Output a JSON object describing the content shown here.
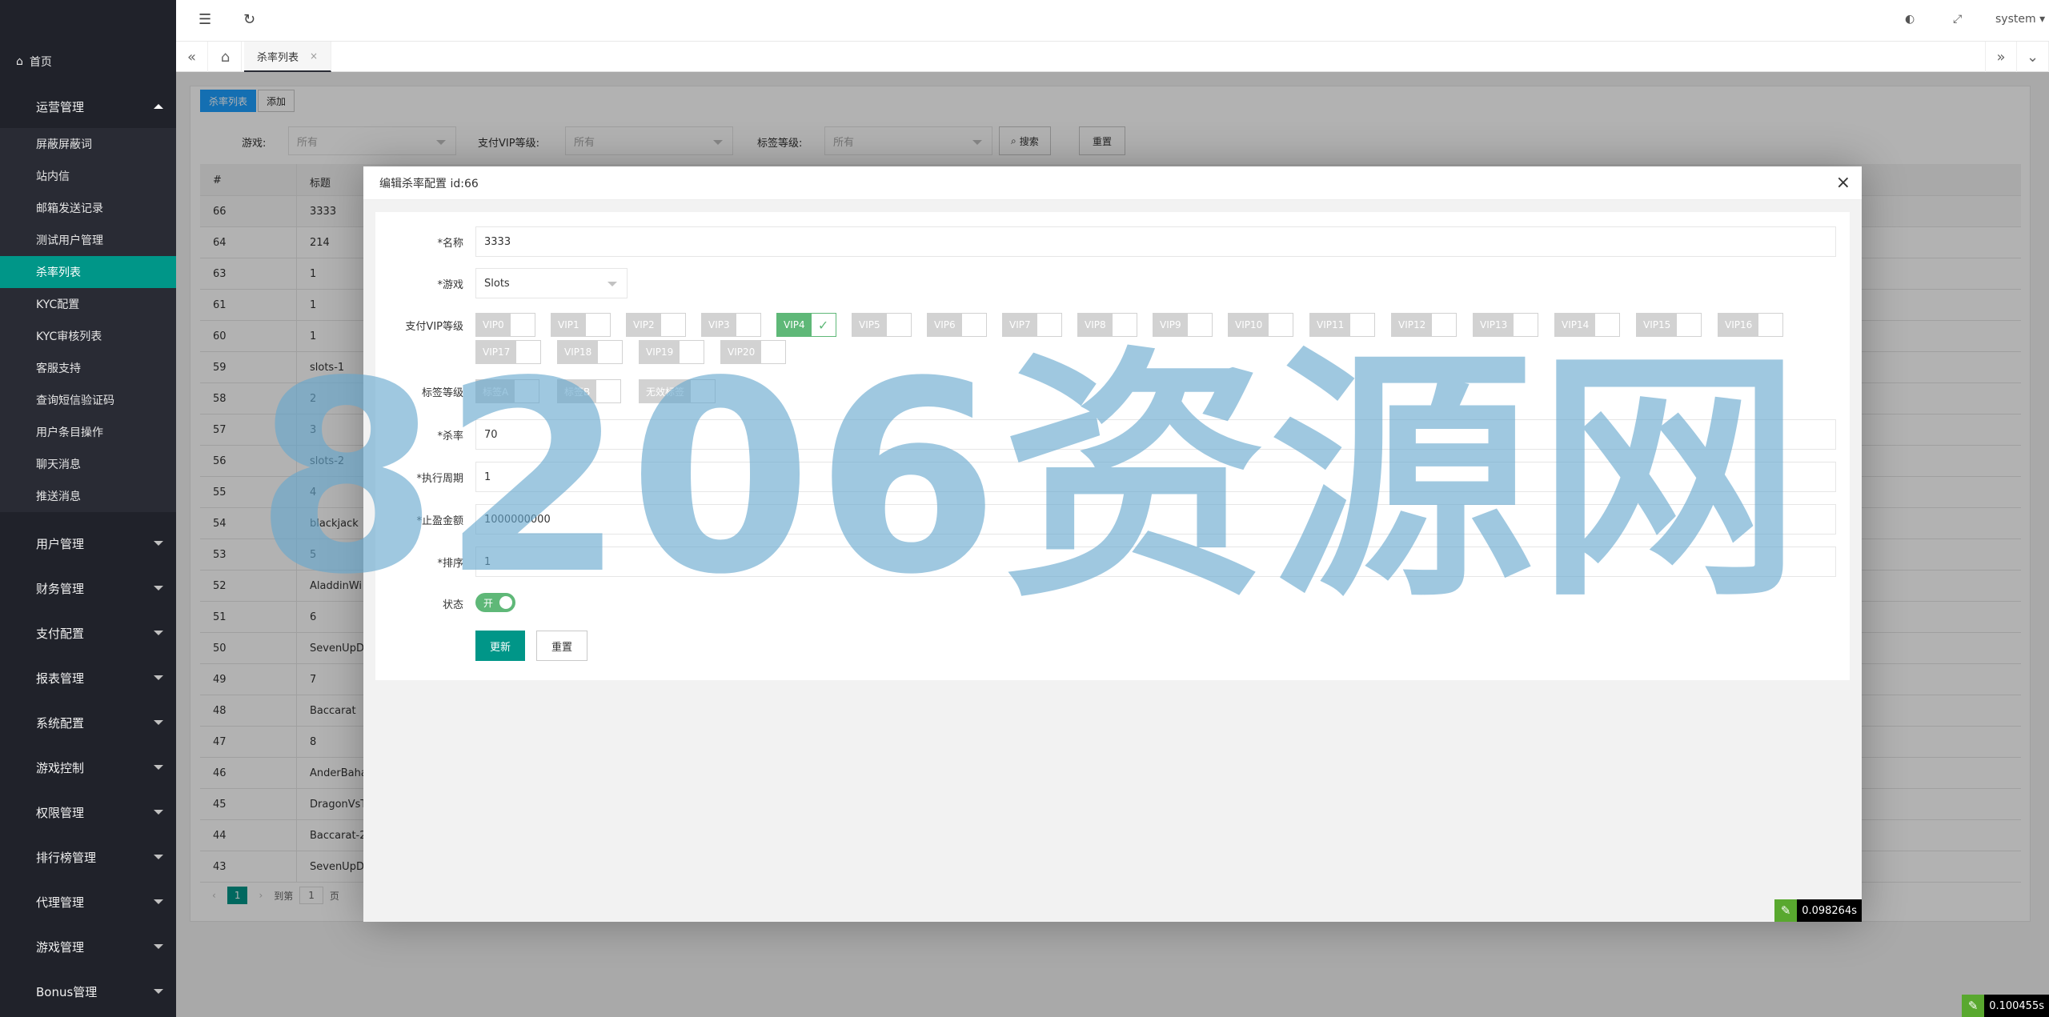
{
  "sidebar": {
    "home_label": "首页",
    "groups": [
      {
        "label": "运营管理",
        "expanded": true
      },
      {
        "label": "用户管理"
      },
      {
        "label": "财务管理"
      },
      {
        "label": "支付配置"
      },
      {
        "label": "报表管理"
      },
      {
        "label": "系统配置"
      },
      {
        "label": "游戏控制"
      },
      {
        "label": "权限管理"
      },
      {
        "label": "排行榜管理"
      },
      {
        "label": "代理管理"
      },
      {
        "label": "游戏管理"
      },
      {
        "label": "Bonus管理"
      }
    ],
    "sub_items": [
      {
        "label": "屏蔽屏蔽词"
      },
      {
        "label": "站内信"
      },
      {
        "label": "邮箱发送记录"
      },
      {
        "label": "测试用户管理"
      },
      {
        "label": "杀率列表",
        "active": true
      },
      {
        "label": "KYC配置"
      },
      {
        "label": "KYC审核列表"
      },
      {
        "label": "客服支持"
      },
      {
        "label": "查询短信验证码"
      },
      {
        "label": "用户条目操作"
      },
      {
        "label": "聊天消息"
      },
      {
        "label": "推送消息"
      }
    ]
  },
  "header": {
    "user": "system",
    "menu_icon": "menu-fold-icon",
    "refresh_icon": "refresh-icon"
  },
  "tabs": {
    "current": "杀率列表",
    "close": "×"
  },
  "content": {
    "btn_list": "杀率列表",
    "btn_add": "添加",
    "filters": {
      "game_label": "游戏:",
      "game_value": "所有",
      "vip_label": "支付VIP等级:",
      "vip_value": "所有",
      "tag_label": "标签等级:",
      "tag_value": "所有",
      "search": "搜索",
      "reset": "重置"
    },
    "table": {
      "headers": [
        "#",
        "标题"
      ],
      "rows": [
        [
          "66",
          "3333"
        ],
        [
          "64",
          "214"
        ],
        [
          "63",
          "1"
        ],
        [
          "61",
          "1"
        ],
        [
          "60",
          "1"
        ],
        [
          "59",
          "slots-1"
        ],
        [
          "58",
          "2"
        ],
        [
          "57",
          "3"
        ],
        [
          "56",
          "slots-2"
        ],
        [
          "55",
          "4"
        ],
        [
          "54",
          "blackjack"
        ],
        [
          "53",
          "5"
        ],
        [
          "52",
          "AladdinWi"
        ],
        [
          "51",
          "6"
        ],
        [
          "50",
          "SevenUpD"
        ],
        [
          "49",
          "7"
        ],
        [
          "48",
          "Baccarat"
        ],
        [
          "47",
          "8"
        ],
        [
          "46",
          "AnderBaha"
        ],
        [
          "45",
          "DragonVsT"
        ],
        [
          "44",
          "Baccarat-2"
        ],
        [
          "43",
          "SevenUpD"
        ]
      ]
    },
    "pager": {
      "current": "1",
      "goto": "到第",
      "input": "1",
      "page": "页"
    }
  },
  "modal": {
    "title": "编辑杀率配置 id:66",
    "fields": {
      "name_label": "*名称",
      "name_value": "3333",
      "game_label": "*游戏",
      "game_value": "Slots",
      "vip_label": "支付VIP等级",
      "vip_options": [
        "VIP0",
        "VIP1",
        "VIP2",
        "VIP3",
        "VIP4",
        "VIP5",
        "VIP6",
        "VIP7",
        "VIP8",
        "VIP9",
        "VIP10",
        "VIP11",
        "VIP12",
        "VIP13",
        "VIP14",
        "VIP15",
        "VIP16",
        "VIP17",
        "VIP18",
        "VIP19",
        "VIP20"
      ],
      "vip_checked": "VIP4",
      "tag_label": "标签等级",
      "tag_options": [
        "标签A",
        "标签B",
        "无效标签"
      ],
      "rate_label": "*杀率",
      "rate_value": "70",
      "period_label": "*执行周期",
      "period_value": "1",
      "stop_label": "*止盈金额",
      "stop_value": "1000000000",
      "sort_label": "*排序",
      "sort_value": "1",
      "status_label": "状态",
      "status_value": "开"
    },
    "update_btn": "更新",
    "reset_btn": "重置"
  },
  "timers": {
    "modal": "0.098264s",
    "page": "0.100455s"
  },
  "watermark": "8206资源网",
  "colors": {
    "accent": "#009688",
    "checked": "#5fb878",
    "sidebar_bg": "#20222a",
    "blue": "#1e9fff"
  }
}
